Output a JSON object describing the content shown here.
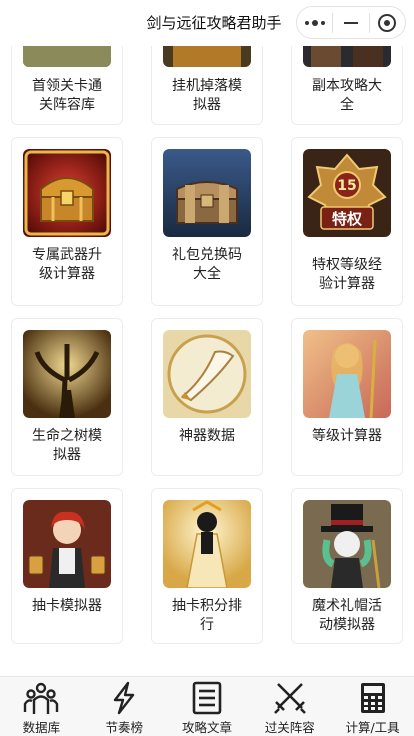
{
  "app": {
    "title": "剑与远征攻略君助手"
  },
  "capsule": {
    "more_icon": "more-dots-icon",
    "minimize_icon": "minimize-icon",
    "close_icon": "target-close-icon"
  },
  "grid": {
    "items": [
      {
        "l1": "首领关卡通",
        "l2": "关阵容库",
        "icon": "boss-stage-icon"
      },
      {
        "l1": "挂机掉落模",
        "l2": "拟器",
        "icon": "idle-drop-icon"
      },
      {
        "l1": "副本攻略大",
        "l2": "全",
        "icon": "dungeon-guide-icon"
      },
      {
        "l1": "专属武器升",
        "l2": "级计算器",
        "icon": "treasure-chest-icon"
      },
      {
        "l1": "礼包兑换码",
        "l2": "大全",
        "icon": "gift-chest-icon"
      },
      {
        "l1": "特权等级经",
        "l2": "验计算器",
        "icon": "vip-badge-icon",
        "badge_num": "15",
        "badge_text": "特权"
      },
      {
        "l1": "生命之树模",
        "l2": "拟器",
        "icon": "tree-of-life-icon"
      },
      {
        "l1": "神器数据",
        "l2": "",
        "icon": "artifact-horn-icon"
      },
      {
        "l1": "等级计算器",
        "l2": "",
        "icon": "hero-portrait-icon"
      },
      {
        "l1": "抽卡模拟器",
        "l2": "",
        "icon": "tavern-maid-icon"
      },
      {
        "l1": "抽卡积分排",
        "l2": "行",
        "icon": "golden-statue-icon"
      },
      {
        "l1": "魔术礼帽活",
        "l2": "动模拟器",
        "icon": "magician-hat-icon"
      }
    ]
  },
  "tabbar": {
    "items": [
      {
        "label": "数据库",
        "icon": "users-icon"
      },
      {
        "label": "节奏榜",
        "icon": "lightning-icon"
      },
      {
        "label": "攻略文章",
        "icon": "document-icon"
      },
      {
        "label": "过关阵容",
        "icon": "crossed-swords-icon"
      },
      {
        "label": "计算/工具",
        "icon": "calculator-icon"
      }
    ]
  },
  "colors": {
    "gold": "#d8a23a",
    "dark_brown": "#3a2416",
    "red": "#a8241c",
    "navy": "#26304a",
    "tabbar_bg": "#f7f7f7"
  }
}
